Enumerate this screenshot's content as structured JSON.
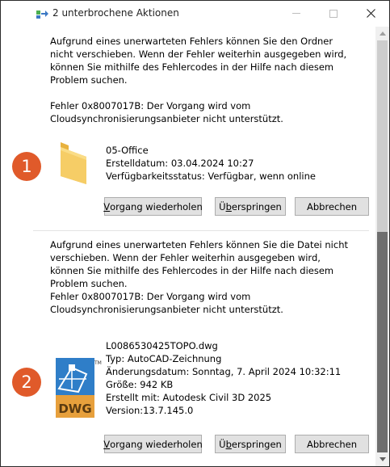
{
  "window": {
    "title": "2 unterbrochene Aktionen"
  },
  "sections": [
    {
      "badge": "1",
      "message": "Aufgrund eines unerwarteten Fehlers können Sie den Ordner nicht verschieben. Wenn der Fehler weiterhin ausgegeben wird, können Sie mithilfe des Fehlercodes in der Hilfe nach diesem Problem suchen.",
      "error": "Fehler 0x8007017B: Der Vorgang wird vom Cloudsynchronisierungsanbieter nicht unterstützt.",
      "icon": "folder-icon",
      "details": [
        "05-Office",
        "Erstelldatum: 03.04.2024 10:27",
        "Verfügbarkeitsstatus: Verfügbar, wenn online"
      ],
      "buttons": {
        "retry_pre": "",
        "retry_u": "V",
        "retry_post": "organg wiederholen",
        "skip_pre": "Ü",
        "skip_u": "b",
        "skip_post": "erspringen",
        "cancel": "Abbrechen"
      }
    },
    {
      "badge": "2",
      "message": "Aufgrund eines unerwarteten Fehlers können Sie die Datei nicht verschieben. Wenn der Fehler weiterhin ausgegeben wird, können Sie mithilfe des Fehlercodes in der Hilfe nach diesem Problem suchen.",
      "error": "Fehler 0x8007017B: Der Vorgang wird vom Cloudsynchronisierungsanbieter nicht unterstützt.",
      "icon": "dwg-file-icon",
      "icon_label": "DWG",
      "icon_tm": "TM",
      "details": [
        "L0086530425TOPO.dwg",
        "Typ: AutoCAD-Zeichnung",
        "Änderungsdatum: Sonntag, 7. April 2024 10:32:11",
        "Größe: 942 KB",
        "Erstellt mit: Autodesk Civil 3D 2025",
        "Version:13.7.145.0"
      ],
      "buttons": {
        "retry_pre": "",
        "retry_u": "V",
        "retry_post": "organg wiederholen",
        "skip_pre": "Ü",
        "skip_u": "b",
        "skip_post": "erspringen",
        "cancel": "Abbrechen"
      }
    }
  ],
  "colors": {
    "badge": "#e05a2a",
    "folder": "#f6c95c",
    "dwg_blue": "#2f7ec8",
    "dwg_orange": "#e7a03c"
  }
}
